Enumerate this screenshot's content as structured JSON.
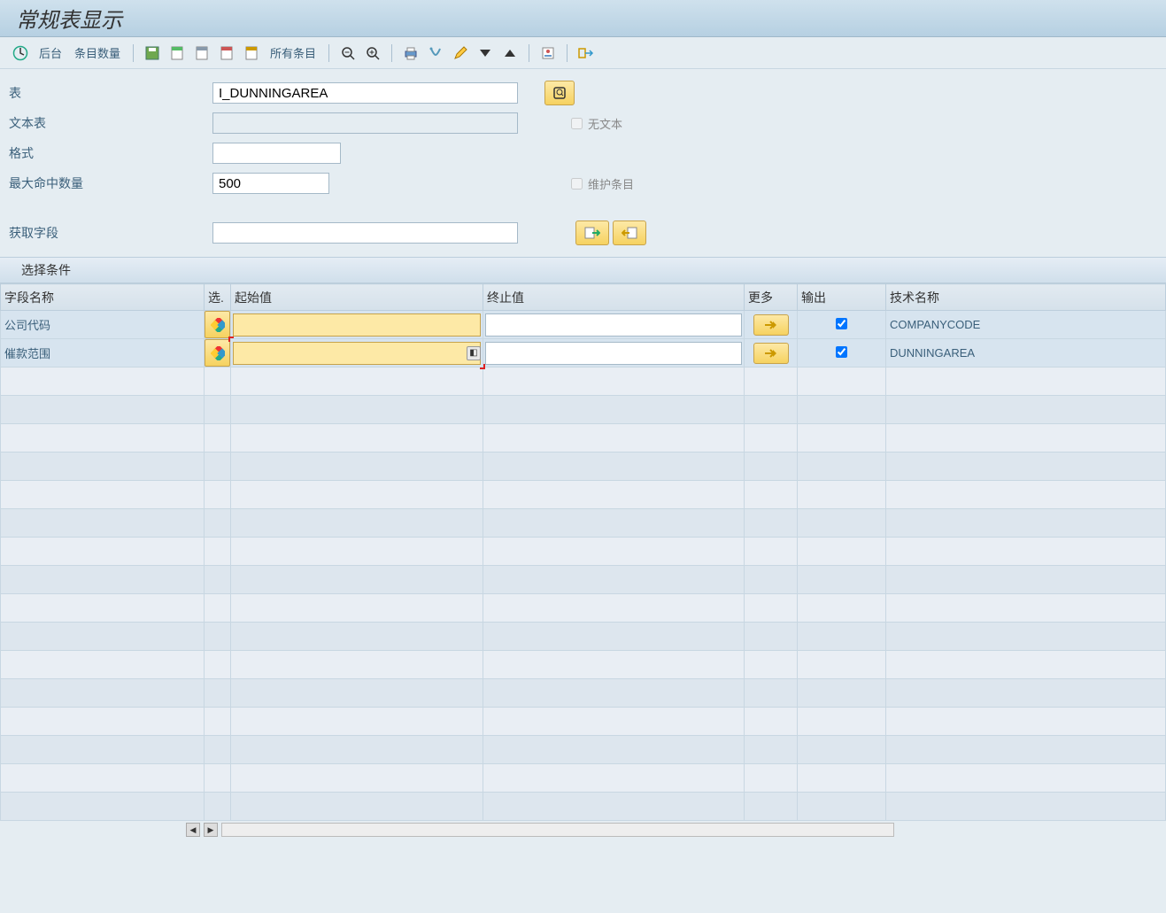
{
  "title": "常规表显示",
  "toolbar": {
    "background_label": "后台",
    "entry_count_label": "条目数量",
    "all_entries_label": "所有条目"
  },
  "form": {
    "table_label": "表",
    "table_value": "I_DUNNINGAREA",
    "text_table_label": "文本表",
    "text_table_value": "",
    "format_label": "格式",
    "format_value": "",
    "max_hits_label": "最大命中数量",
    "max_hits_value": "500",
    "no_text_label": "无文本",
    "maintain_entries_label": "维护条目",
    "fetch_fields_label": "获取字段",
    "fetch_fields_value": ""
  },
  "section_header": "选择条件",
  "columns": {
    "field_name": "字段名称",
    "selection": "选.",
    "from_value": "起始值",
    "to_value": "终止值",
    "more": "更多",
    "output": "输出",
    "tech_name": "技术名称"
  },
  "rows": [
    {
      "field": "公司代码",
      "tech": "COMPANYCODE",
      "output": true,
      "active": false
    },
    {
      "field": "催款范围",
      "tech": "DUNNINGAREA",
      "output": true,
      "active": true
    }
  ]
}
